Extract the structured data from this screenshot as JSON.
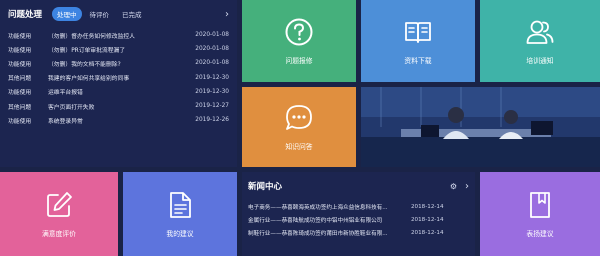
{
  "issues": {
    "title": "问题处理",
    "tabs": [
      {
        "label": "处理中",
        "active": true
      },
      {
        "label": "待评价",
        "active": false
      },
      {
        "label": "已完成",
        "active": false
      }
    ],
    "rows": [
      {
        "category": "功能使用",
        "text": "（勿删）督办任务如何修改监控人",
        "date": "2020-01-08"
      },
      {
        "category": "功能使用",
        "text": "（勿删）PR订单审批流程漏了",
        "date": "2020-01-08"
      },
      {
        "category": "功能使用",
        "text": "（勿删）我的文档不能删除?",
        "date": "2020-01-08"
      },
      {
        "category": "其他问题",
        "text": "我建的客户如何共享给别的同事",
        "date": "2019-12-30"
      },
      {
        "category": "功能使用",
        "text": "运维平台报错",
        "date": "2019-12-30"
      },
      {
        "category": "其他问题",
        "text": "客户页面打开失败",
        "date": "2019-12-27"
      },
      {
        "category": "功能使用",
        "text": "系统登录异常",
        "date": "2019-12-26"
      }
    ]
  },
  "tiles": {
    "repair": {
      "label": "问题报修",
      "icon": "question-circle-icon",
      "color": "#45b07c"
    },
    "download": {
      "label": "资料下载",
      "icon": "open-book-icon",
      "color": "#4d8fd8"
    },
    "training": {
      "label": "培训通知",
      "icon": "user-group-icon",
      "color": "#3fb3a8"
    },
    "qa": {
      "label": "知识问答",
      "icon": "chat-bubble-icon",
      "color": "#e08f3f"
    },
    "satisfaction": {
      "label": "满意度评价",
      "icon": "edit-icon",
      "color": "#e3629a"
    },
    "suggestion": {
      "label": "我的建议",
      "icon": "document-icon",
      "color": "#5d74dd"
    },
    "praise": {
      "label": "表扬建议",
      "icon": "bookmark-book-icon",
      "color": "#9a6de0"
    }
  },
  "news": {
    "title": "新闻中心",
    "rows": [
      {
        "text": "电子商务——恭喜颐海英成功签约上海众益信息科技有...",
        "date": "2018-12-14"
      },
      {
        "text": "金属行业——恭喜陆航成功签约中铝中州铝业有限公司",
        "date": "2018-12-14"
      },
      {
        "text": "制鞋行业——恭喜陈琦成功签约莆田市新协胜鞋业有限...",
        "date": "2018-12-14"
      }
    ]
  }
}
